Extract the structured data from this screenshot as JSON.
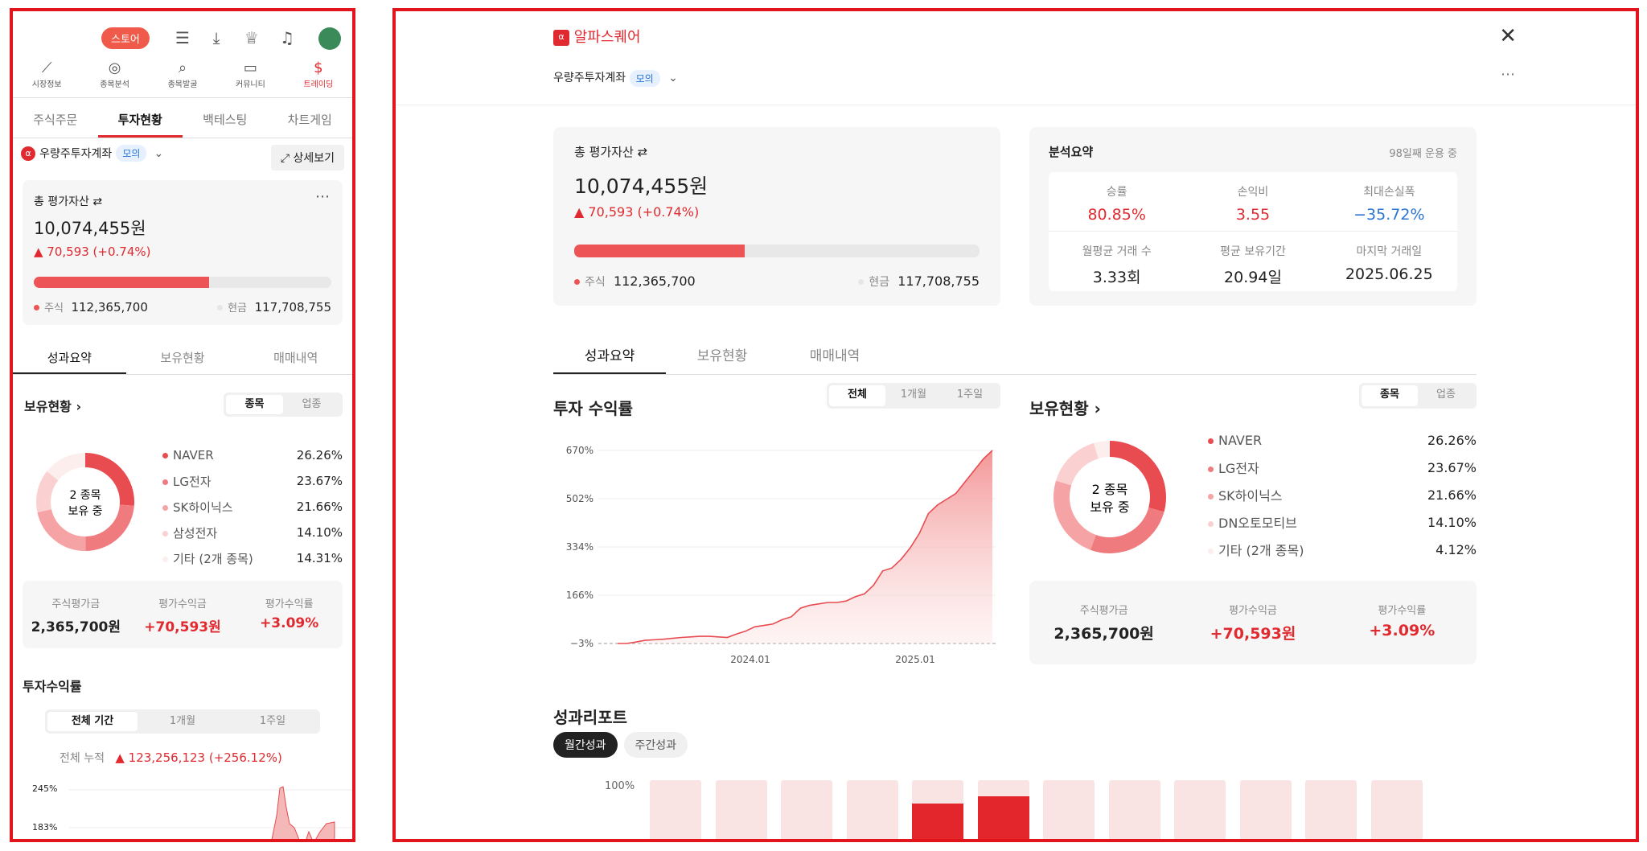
{
  "left": {
    "store_label": "스토어",
    "nav": [
      {
        "icon": "chart-line-icon",
        "label": "시장정보"
      },
      {
        "icon": "analysis-icon",
        "label": "종목분석"
      },
      {
        "icon": "search-icon",
        "label": "종목발굴"
      },
      {
        "icon": "chat-icon",
        "label": "커뮤니티"
      },
      {
        "icon": "trading-icon",
        "label": "트레이딩"
      }
    ],
    "tabs": [
      "주식주문",
      "투자현황",
      "백테스팅",
      "차트게임"
    ],
    "account": {
      "name": "우량주투자계좌",
      "badge": "모의",
      "detail": "상세보기"
    },
    "asset": {
      "label": "총 평가자산",
      "total": "10,074,455원",
      "change": "▲ 70,593 (+0.74%)",
      "stock_label": "주식",
      "stock": "112,365,700",
      "cash_label": "현금",
      "cash": "117,708,755",
      "stock_ratio": 0.59
    },
    "subtabs": [
      "성과요약",
      "보유현황",
      "매매내역"
    ],
    "holdings_title": "보유현황",
    "seg": [
      "종목",
      "업종"
    ],
    "donut_text": [
      "2 종목",
      "보유 중"
    ],
    "legend": [
      {
        "name": "NAVER",
        "pct": "26.26%",
        "color": "#e84b50"
      },
      {
        "name": "LG전자",
        "pct": "23.67%",
        "color": "#f07b7e"
      },
      {
        "name": "SK하이닉스",
        "pct": "21.66%",
        "color": "#f5a3a5"
      },
      {
        "name": "삼성전자",
        "pct": "14.10%",
        "color": "#fad0d1"
      },
      {
        "name": "기타 (2개 종목)",
        "pct": "14.31%",
        "color": "#fdeeee"
      }
    ],
    "stats": [
      {
        "label": "주식평가금",
        "value": "2,365,700원"
      },
      {
        "label": "평가수익금",
        "value": "+70,593원"
      },
      {
        "label": "평가수익률",
        "value": "+3.09%"
      }
    ],
    "return_title": "투자수익률",
    "period_seg": [
      "전체 기간",
      "1개월",
      "1주일"
    ],
    "cumulative_label": "전체 누적",
    "cumulative_value": "▲ 123,256,123  (+256.12%)",
    "yticks": [
      "245%",
      "183%"
    ]
  },
  "right": {
    "brand": "알파스퀘어",
    "account": {
      "name": "우량주투자계좌",
      "badge": "모의"
    },
    "asset": {
      "label": "총 평가자산",
      "total": "10,074,455원",
      "change": "▲ 70,593 (+0.74%)",
      "stock_label": "주식",
      "stock": "112,365,700",
      "cash_label": "현금",
      "cash": "117,708,755",
      "stock_ratio": 0.42
    },
    "analysis": {
      "title": "분석요약",
      "days": "98일째 운용 중",
      "items": [
        {
          "label": "승률",
          "value": "80.85%",
          "tone": "red"
        },
        {
          "label": "손익비",
          "value": "3.55",
          "tone": "red"
        },
        {
          "label": "최대손실폭",
          "value": "−35.72%",
          "tone": "blue"
        },
        {
          "label": "월평균 거래 수",
          "value": "3.33회",
          "tone": "dark"
        },
        {
          "label": "평균 보유기간",
          "value": "20.94일",
          "tone": "dark"
        },
        {
          "label": "마지막 거래일",
          "value": "2025.06.25",
          "tone": "dark"
        }
      ]
    },
    "tabs": [
      "성과요약",
      "보유현황",
      "매매내역"
    ],
    "return_title": "투자 수익률",
    "period_seg": [
      "전체",
      "1개월",
      "1주일"
    ],
    "holdings_title": "보유현황",
    "seg": [
      "종목",
      "업종"
    ],
    "donut_text": [
      "2 종목",
      "보유 중"
    ],
    "legend": [
      {
        "name": "NAVER",
        "pct": "26.26%",
        "color": "#e84b50"
      },
      {
        "name": "LG전자",
        "pct": "23.67%",
        "color": "#f07b7e"
      },
      {
        "name": "SK하이닉스",
        "pct": "21.66%",
        "color": "#f5a3a5"
      },
      {
        "name": "DN오토모티브",
        "pct": "14.10%",
        "color": "#fad0d1"
      },
      {
        "name": "기타 (2개 종목)",
        "pct": "4.12%",
        "color": "#fdeeee"
      }
    ],
    "stats": [
      {
        "label": "주식평가금",
        "value": "2,365,700원"
      },
      {
        "label": "평가수익금",
        "value": "+70,593원"
      },
      {
        "label": "평가수익률",
        "value": "+3.09%"
      }
    ],
    "report_title": "성과리포트",
    "report_tabs": [
      "월간성과",
      "주간성과"
    ],
    "report_ytick": "100%"
  },
  "chart_data": {
    "type": "area",
    "yticks": [
      "670%",
      "502%",
      "334%",
      "166%",
      "−3%"
    ],
    "xticks": [
      "2024.01",
      "2025.01"
    ],
    "ylim": [
      -3,
      670
    ],
    "series": [
      {
        "values": [
          -3,
          -3,
          2,
          8,
          10,
          12,
          15,
          18,
          20,
          22,
          22,
          20,
          18,
          30,
          40,
          55,
          60,
          65,
          80,
          90,
          120,
          130,
          135,
          140,
          140,
          145,
          160,
          170,
          200,
          250,
          260,
          290,
          330,
          380,
          450,
          480,
          500,
          520,
          560,
          600,
          640,
          670
        ]
      }
    ]
  },
  "report_bars": [
    0.0,
    0.12,
    0.0,
    0.0,
    0.68,
    0.78,
    0.0,
    0.0,
    0.0,
    0.0,
    0.0,
    0.0
  ]
}
